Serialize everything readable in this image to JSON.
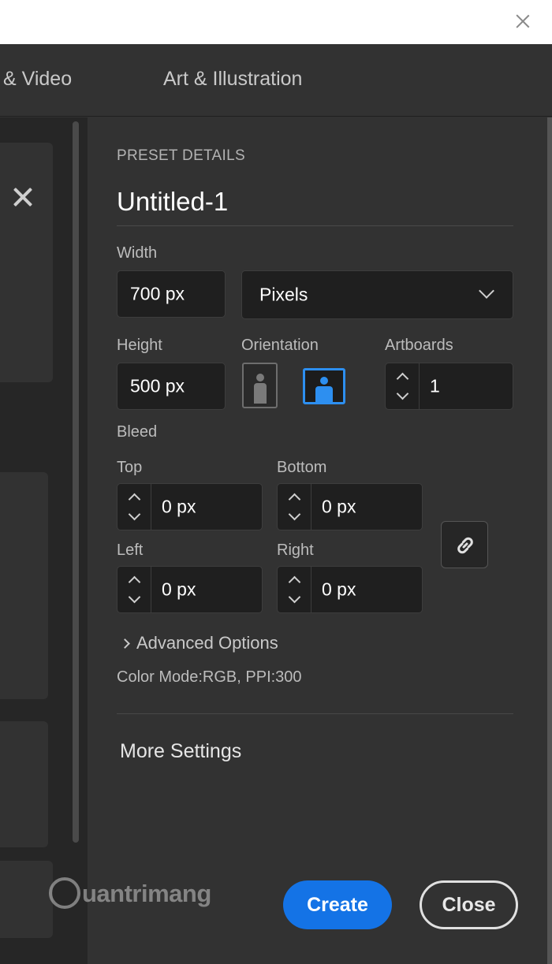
{
  "tabs": [
    {
      "label": "& Video"
    },
    {
      "label": "Art & Illustration"
    }
  ],
  "preset": {
    "section_title": "PRESET DETAILS",
    "doc_name": "Untitled-1",
    "width_label": "Width",
    "width_value": "700 px",
    "units": "Pixels",
    "height_label": "Height",
    "height_value": "500 px",
    "orientation_label": "Orientation",
    "orientation_selected": "landscape",
    "artboards_label": "Artboards",
    "artboards_value": "1",
    "bleed_label": "Bleed",
    "bleed": {
      "top_label": "Top",
      "top_value": "0 px",
      "bottom_label": "Bottom",
      "bottom_value": "0 px",
      "left_label": "Left",
      "left_value": "0 px",
      "right_label": "Right",
      "right_value": "0 px"
    },
    "advanced_options": "Advanced Options",
    "color_mode": "Color Mode:RGB, PPI:300",
    "more_settings": "More Settings"
  },
  "buttons": {
    "create": "Create",
    "close": "Close"
  },
  "watermark": "uantrimang",
  "colors": {
    "accent": "#1473e6",
    "selected_orientation": "#2d8ff0",
    "panel_bg": "#323232"
  }
}
